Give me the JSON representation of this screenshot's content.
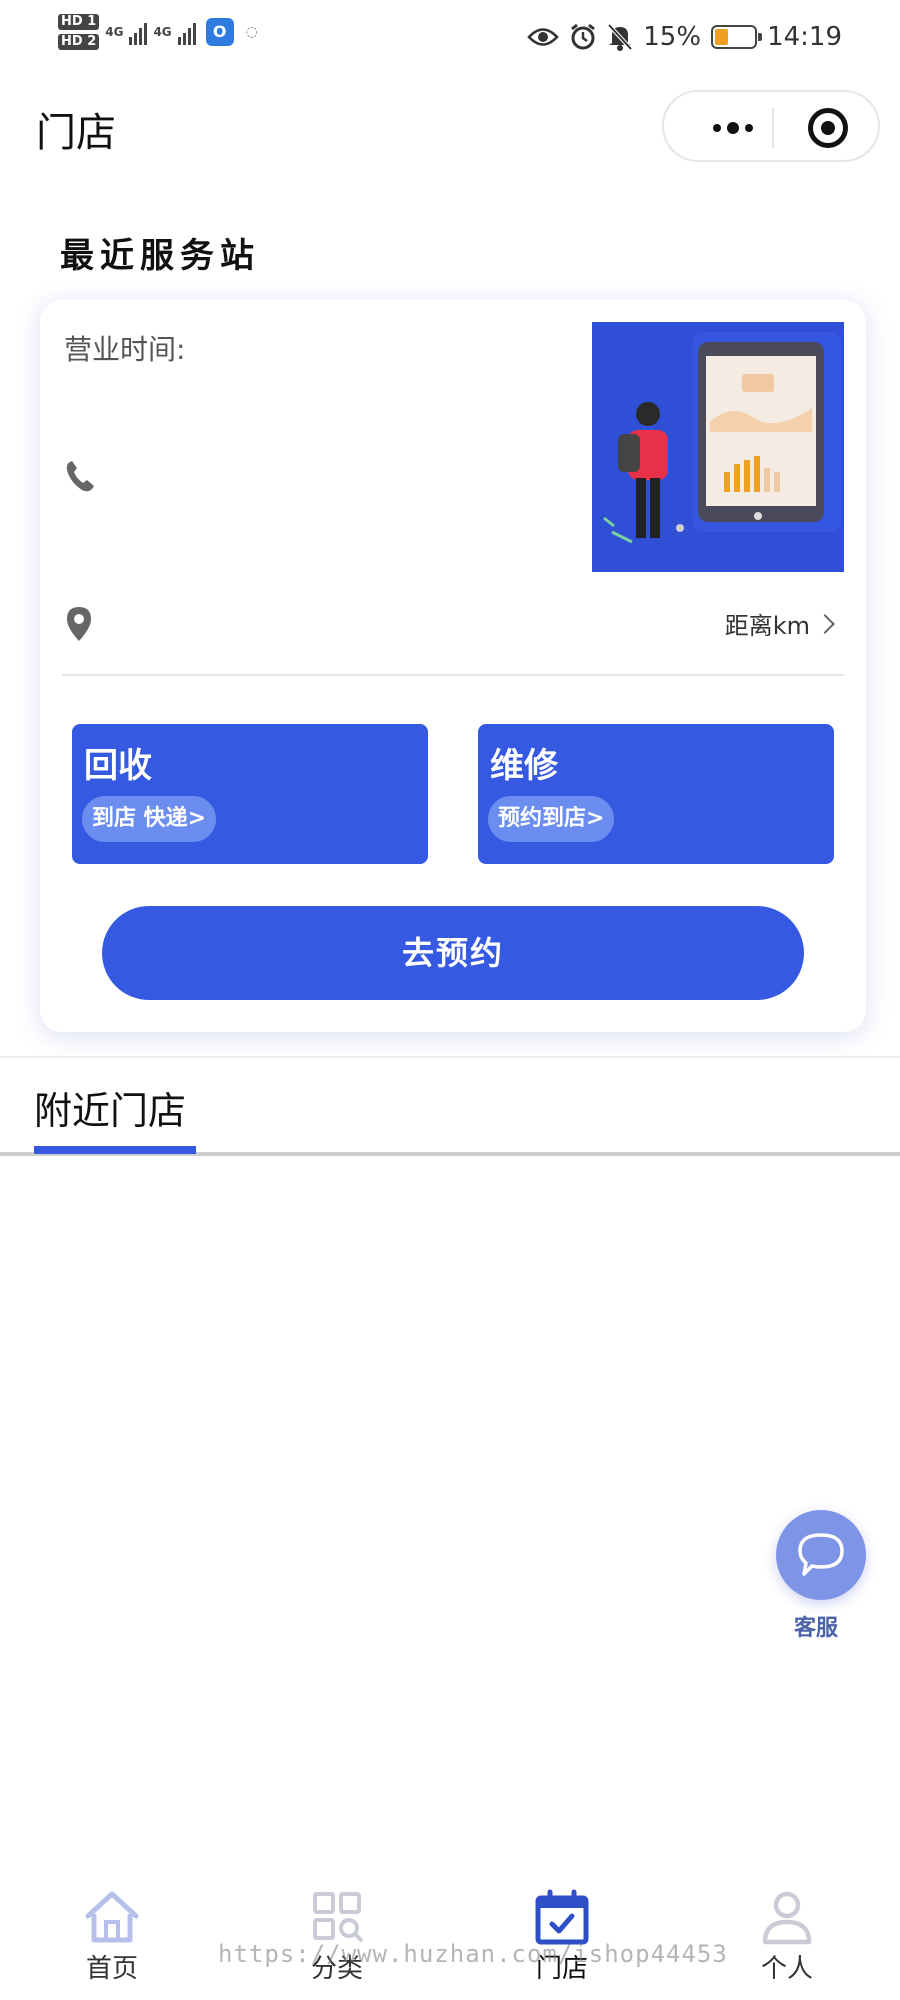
{
  "status_bar": {
    "hd1": "HD 1",
    "hd2": "HD 2",
    "net1": "4G",
    "net2": "4G",
    "battery_text": "15%",
    "battery_level": 0.15,
    "time": "14:19",
    "app_badge": "O"
  },
  "nav": {
    "title": "门店"
  },
  "nearest": {
    "section_title": "最近服务站",
    "hours_label": "营业时间:",
    "distance_text": "距离km",
    "services": [
      {
        "title": "回收",
        "tag": "到店 快递>"
      },
      {
        "title": "维修",
        "tag": "预约到店>"
      }
    ],
    "book_button": "去预约"
  },
  "nearby": {
    "tab_label": "附近门店"
  },
  "customer_service": {
    "label": "客服"
  },
  "tabbar": {
    "items": [
      {
        "label": "首页",
        "icon": "home-icon"
      },
      {
        "label": "分类",
        "icon": "grid-icon"
      },
      {
        "label": "门店",
        "icon": "calendar-check-icon"
      },
      {
        "label": "个人",
        "icon": "user-icon"
      }
    ]
  },
  "watermark": "https://www.huzhan.com/ishop44453",
  "colors": {
    "accent": "#3559e0",
    "pill": "#6b8df0",
    "cs_button": "#7e94e6"
  }
}
